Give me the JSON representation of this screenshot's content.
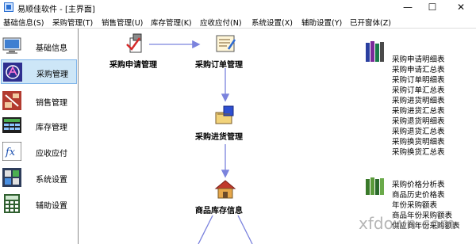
{
  "window": {
    "title": "易顺佳软件 - [主界面]",
    "minimize": "—",
    "maximize": "☐",
    "close": "✕"
  },
  "menu": [
    "基础信息(S)",
    "采购管理(T)",
    "销售管理(U)",
    "库存管理(K)",
    "应收应付(N)",
    "系统设置(X)",
    "辅助设置(Y)",
    "已开窗体(Z)"
  ],
  "sidebar": {
    "items": [
      {
        "label": "基础信息",
        "icon": "monitor-icon"
      },
      {
        "label": "采购管理",
        "icon": "shopping-icon"
      },
      {
        "label": "销售管理",
        "icon": "scales-icon"
      },
      {
        "label": "库存管理",
        "icon": "spreadsheet-icon"
      },
      {
        "label": "应收应付",
        "icon": "formula-icon"
      },
      {
        "label": "系统设置",
        "icon": "settings-icon"
      },
      {
        "label": "辅助设置",
        "icon": "calculator-icon"
      }
    ]
  },
  "flow": {
    "nodes": [
      "采购申请管理",
      "采购订单管理",
      "采购进货管理",
      "商品库存信息"
    ]
  },
  "reports": {
    "group1": [
      "采购申请明细表",
      "采购申请汇总表",
      "采购订单明细表",
      "采购订单汇总表",
      "采购进货明细表",
      "采购进货汇总表",
      "采购退货明细表",
      "采购退货汇总表",
      "采购换货明细表",
      "采购换货汇总表"
    ],
    "group2": [
      "采购价格分析表",
      "商品历史价格表",
      "年份采购额表",
      "商品年份采购额表",
      "供应商年份采购额表"
    ]
  },
  "watermark": "xfdown.com",
  "colors": {
    "arrow": "#7b83dd",
    "active_bg": "#cde6f7",
    "active_border": "#7eb4ea"
  }
}
